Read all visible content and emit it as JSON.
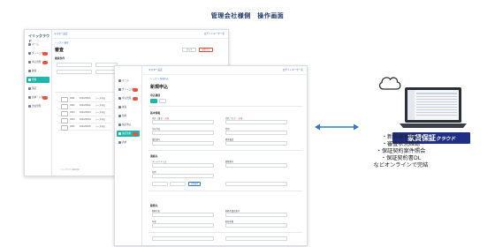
{
  "title": "管理会社様側　操作画面",
  "back_window": {
    "logo": "イリックラウド",
    "topbar_left": "マスター設定",
    "topbar_right": "ログインユーザー名",
    "crumb": "トップ > 審査",
    "heading": "審査",
    "section": "検索条件",
    "nav": [
      "ホーム",
      "ダッシュボード",
      "申込管理",
      "審査",
      "契約",
      "保証",
      "請求・入金",
      "支払管理"
    ],
    "search_button": "検索する",
    "clear_button": "クリア",
    "rows": [
      {
        "id": "0001",
        "date": "2020/06/01",
        "text": "リース申込"
      },
      {
        "id": "0002",
        "date": "2020/06/02",
        "text": "リース申込"
      },
      {
        "id": "0003",
        "date": "2020/06/03",
        "text": "リース申込"
      },
      {
        "id": "0004",
        "date": "2020/06/04",
        "text": "リース申込"
      },
      {
        "id": "0005",
        "date": "2020/06/05",
        "text": "リース申込"
      }
    ],
    "footer": "イリックラウド株式会社"
  },
  "front_window": {
    "topbar_left": "マスター設定",
    "topbar_right": "ログインユーザー名",
    "crumb": "トップ > 新規申込",
    "heading": "新規申込",
    "section1": "申込種別",
    "section2": "基本情報",
    "section3": "連絡先",
    "section4": "勤務先",
    "nav": [
      "ホーム",
      "ダッシュボード",
      "申込管理",
      "審査",
      "契約",
      "保証申込",
      "保証契約",
      "請求"
    ],
    "labels": {
      "name": "氏名（漢字）",
      "name_kana": "氏名（カナ）",
      "birth": "生年月日",
      "gender": "性別",
      "phone": "電話番号",
      "mobile": "携帯電話",
      "email": "メールアドレス",
      "zip": "郵便番号",
      "address": "住所",
      "company": "勤務先名",
      "company_tel": "勤務先電話番号",
      "income": "年収",
      "years": "勤続年数"
    },
    "required_mark": "必須",
    "search_zip_button": "住所検索"
  },
  "bullets": [
    "・新規審査申込",
    "・審査状況確認",
    "・保証契約案件照会",
    "・保証契約書DL",
    "などオンラインで完結"
  ],
  "brand": {
    "main": "家賃保証",
    "sub": "クラウド"
  },
  "colors": {
    "accent": "#1db6a8",
    "navy": "#1f2f86",
    "arrow": "#3a78c4"
  }
}
